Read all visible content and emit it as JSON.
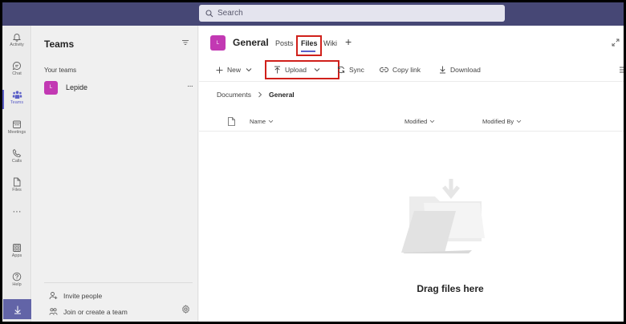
{
  "search": {
    "placeholder": "Search"
  },
  "rail": {
    "items": [
      {
        "label": "Activity",
        "icon": "bell-icon"
      },
      {
        "label": "Chat",
        "icon": "chat-icon"
      },
      {
        "label": "Teams",
        "icon": "teams-icon"
      },
      {
        "label": "Meetings",
        "icon": "calendar-icon"
      },
      {
        "label": "Calls",
        "icon": "phone-icon"
      },
      {
        "label": "Files",
        "icon": "file-icon"
      },
      {
        "label": "Apps",
        "icon": "apps-icon"
      },
      {
        "label": "Help",
        "icon": "help-icon"
      }
    ],
    "more": "···"
  },
  "teams_panel": {
    "title": "Teams",
    "section_label": "Your teams",
    "team": {
      "avatar": "L",
      "name": "Lepide",
      "more": "···"
    },
    "invite": "Invite people",
    "join": "Join or create a team"
  },
  "channel": {
    "avatar": "L",
    "name": "General",
    "tabs": [
      "Posts",
      "Files",
      "Wiki"
    ],
    "add_tab": "+"
  },
  "toolbar": {
    "new": "New",
    "upload": "Upload",
    "sync": "Sync",
    "copy_link": "Copy link",
    "download": "Download"
  },
  "breadcrumb": {
    "root": "Documents",
    "current": "General"
  },
  "columns": {
    "name": "Name",
    "modified": "Modified",
    "modified_by": "Modified By"
  },
  "empty_state": {
    "message": "Drag files here"
  },
  "colors": {
    "brand": "#464775",
    "accent": "#5b5fc7",
    "team_avatar": "#c239b3",
    "highlight": "#d0201b"
  }
}
